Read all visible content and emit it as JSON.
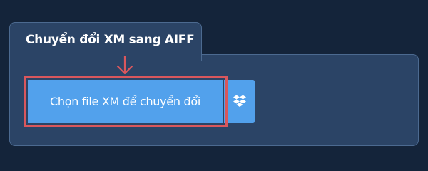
{
  "converter": {
    "tab_title": "Chuyển đổi XM sang AIFF",
    "choose_file_label": "Chọn file XM để chuyển đổi",
    "dropbox_icon": "dropbox-icon"
  },
  "colors": {
    "page_background": "#14243a",
    "panel_background": "#2b4466",
    "button": "#52a1ec",
    "highlight": "#d9575d"
  }
}
